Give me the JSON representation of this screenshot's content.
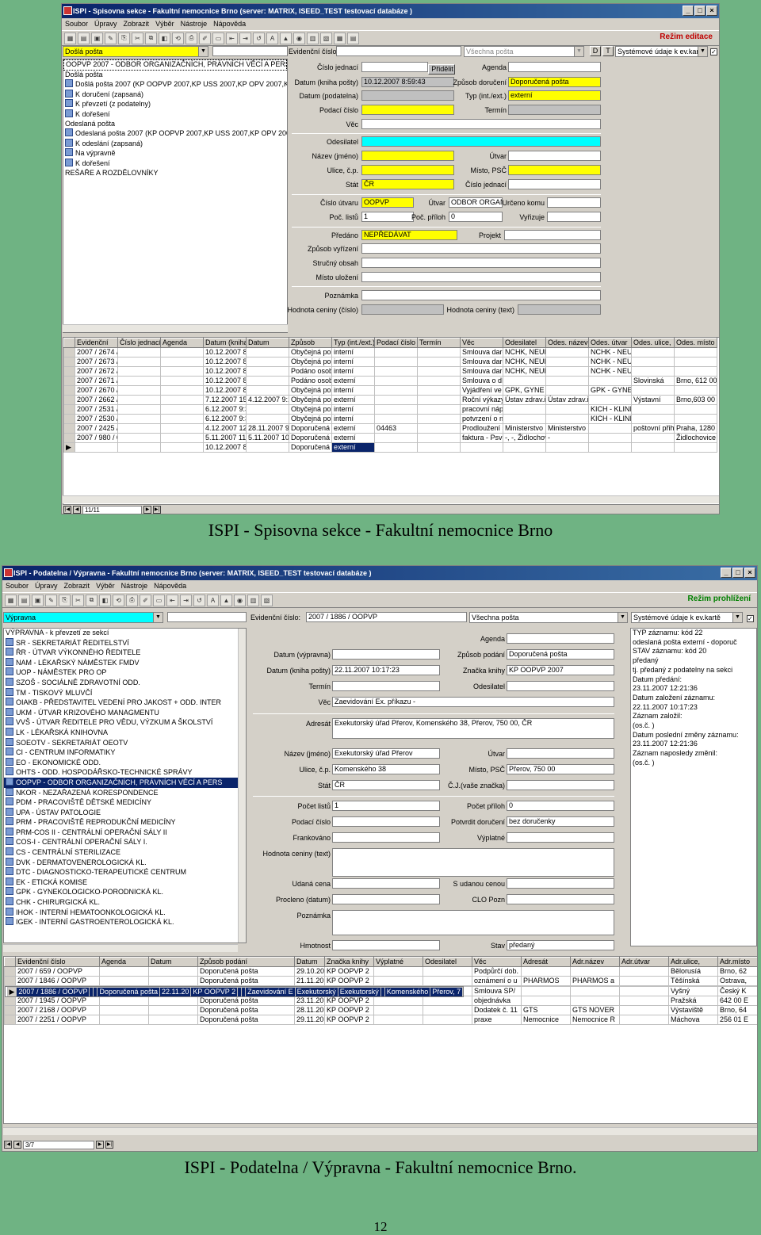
{
  "s1": {
    "title": "ISPI - Spisovna sekce - Fakultní nemocnice Brno (server: MATRIX, ISEED_TEST testovací databáze )",
    "menu": [
      "Soubor",
      "Úpravy",
      "Zobrazit",
      "Výběr",
      "Nástroje",
      "Nápověda"
    ],
    "mode": "Režim editace",
    "left_select": "Došlá pošta",
    "ev_label": "Evidenční číslo:",
    "posta_select": "Všechna pošta",
    "btn_d": "D",
    "btn_t": "T",
    "sys_select": "Systémové údaje k ev.kartě",
    "tree": [
      "OOPVP 2007 - ODBOR ORGANIZAČNÍCH, PRÁVNÍCH VĚCÍ A PERSONÁL",
      "Došlá pošta",
      "Došlá pošta 2007 (KP OOPVP 2007,KP USS 2007,KP OPV 2007,KP O",
      "K doručení (zapsaná)",
      "K převzetí (z podatelny)",
      "K dořešení",
      "Odeslaná pošta",
      "Odeslaná pošta 2007 (KP OOPVP 2007,KP USS 2007,KP OPV 2007,K",
      "K odeslání (zapsaná)",
      "Na výpravně",
      "K dořešení",
      "REŠAŘE A ROZDĚLOVNÍKY"
    ],
    "form": {
      "cislo_jednaci": "Číslo jednací",
      "pridelit": "Přidělit",
      "agenda": "Agenda",
      "datum_kniha": "Datum (kniha pošty)",
      "datum_kniha_v": "10.12.2007 8:59:43",
      "zpusob_doruceni": "Způsob doručení",
      "zpusob_doruceni_v": "Doporučená pošta",
      "datum_podatelna": "Datum (podatelna)",
      "typ": "Typ (int./ext.)",
      "typ_v": "externí",
      "podaci_cislo": "Podací číslo",
      "termin": "Termín",
      "vec": "Věc",
      "odesilatel": "Odesilatel",
      "nazev": "Název (jméno)",
      "utvar": "Útvar",
      "ulice": "Ulice, č.p.",
      "misto": "Místo, PSČ",
      "stat": "Stát",
      "stat_v": "ČR",
      "cislo_jednaci2": "Číslo jednací",
      "cislo_utvaru": "Číslo útvaru",
      "cislo_utvaru_v": "OOPVP",
      "utvar2": "Útvar",
      "utvar2_v": "ODBOR ORGAN",
      "urceno": "Určeno komu",
      "poc_listu": "Poč. listů",
      "poc_listu_v": "1",
      "poc_priloh": "Poč. příloh",
      "poc_priloh_v": "0",
      "vyrizuje": "Vyřizuje",
      "predano": "Předáno",
      "predano_v": "NEPŘEDÁVAT",
      "projekt": "Projekt",
      "zpusob_vyrizeni": "Způsob vyřízení",
      "strucny_obsah": "Stručný obsah",
      "misto_ulozeni": "Místo uložení",
      "poznamka": "Poznámka",
      "hodnota_cislo": "Hodnota ceniny (číslo)",
      "hodnota_text": "Hodnota ceniny (text)"
    },
    "cols": [
      "Evidenční",
      "Číslo jednací",
      "Agenda",
      "Datum (kniha",
      "Datum",
      "Způsob",
      "Typ (int./ext.)",
      "Podací číslo",
      "Termín",
      "Věc",
      "Odesilatel",
      "Odes. název",
      "Odes. útvar",
      "Odes. ulice,",
      "Odes. místo"
    ],
    "rows": [
      [
        "2007 / 2674 /",
        "",
        "",
        "10.12.2007 8:",
        "",
        "Obyčejná poš",
        "interní",
        "",
        "",
        "Smlouva daro",
        "NCHK, NEUR",
        "",
        "NCHK - NEUR",
        "",
        ""
      ],
      [
        "2007 / 2673 /",
        "",
        "",
        "10.12.2007 8:",
        "",
        "Obyčejná poš",
        "interní",
        "",
        "",
        "Smlouva daro",
        "NCHK, NEUR",
        "",
        "NCHK - NEUR",
        "",
        ""
      ],
      [
        "2007 / 2672 /",
        "",
        "",
        "10.12.2007 8:",
        "",
        "Podáno osob",
        "interní",
        "",
        "",
        "Smlouva daro",
        "NCHK, NEUR",
        "",
        "NCHK - NEUR",
        "",
        ""
      ],
      [
        "2007 / 2671 /",
        "",
        "",
        "10.12.2007 8:",
        "",
        "Podáno osob",
        "externí",
        "",
        "",
        "Smlouva o dí",
        "",
        "",
        "",
        "Slovinská",
        "Brno, 612 00"
      ],
      [
        "2007 / 2670 /",
        "",
        "",
        "10.12.2007 8:",
        "",
        "Obyčejná poš",
        "interní",
        "",
        "",
        "Vyjádření ve",
        "GPK, GYNE",
        "",
        "GPK - GYNE",
        "",
        ""
      ],
      [
        "2007 / 2662 /",
        "",
        "",
        "7.12.2007 15:",
        "4.12.2007 9:1",
        "Obyčejná poš",
        "externí",
        "",
        "",
        "Roční výkazy",
        "Ústav zdrav.in",
        "Ústav zdrav.ir",
        "",
        "Výstavní",
        "Brno,603 00"
      ],
      [
        "2007 / 2531 /",
        "",
        "",
        "6.12.2007 9:3",
        "",
        "Obyčejná poš",
        "interní",
        "",
        "",
        "pracovní náplň",
        "",
        "",
        "KICH - KLINI",
        "",
        ""
      ],
      [
        "2007 / 2530 /",
        "",
        "",
        "6.12.2007 9:3",
        "",
        "Obyčejná poš",
        "interní",
        "",
        "",
        "potvrzení o ná",
        "",
        "",
        "KICH - KLINI",
        "",
        ""
      ],
      [
        "2007 / 2425 /",
        "",
        "",
        "4.12.2007 12:",
        "28.11.2007 9:",
        "Doporučená p",
        "externí",
        "04463",
        "",
        "Prodloužení s",
        "Ministerstvo z",
        "Ministerstvo z",
        "",
        "poštovní přihr.",
        "Praha, 1280"
      ],
      [
        "2007 / 980 / 0",
        "",
        "",
        "5.11.2007 11:",
        "5.11.2007 10:",
        "Doporučená p",
        "externí",
        "",
        "",
        "faktura - Psve",
        "-, -, Židlochov",
        "-",
        "",
        "",
        "Židlochovice"
      ],
      [
        "",
        "",
        "",
        "10.12.2007 8:",
        "",
        "Doporučená p",
        "externí",
        "",
        "",
        "",
        "",
        "",
        "",
        "",
        ""
      ]
    ],
    "nav": "11/11"
  },
  "caption1": "ISPI - Spisovna sekce - Fakultní nemocnice Brno",
  "s2": {
    "title": "ISPI - Podatelna / Výpravna - Fakultní nemocnice Brno (server: MATRIX, ISEED_TEST testovací databáze )",
    "menu": [
      "Soubor",
      "Úpravy",
      "Zobrazit",
      "Výběr",
      "Nástroje",
      "Nápověda"
    ],
    "mode": "Režim prohlížení",
    "left_select": "Výpravna",
    "ev_label": "Evidenční číslo:",
    "ev_value": "2007 / 1886 / OOPVP",
    "posta_select": "Všechna pošta",
    "sys_select": "Systémové údaje k ev.kartě",
    "tree": [
      "VÝPRAVNA - k převzetí ze sekcí",
      "SR - SEKRETARIÁT ŘEDITELSTVÍ",
      "ŘR - ÚTVAR VÝKONNÉHO ŘEDITELE",
      "NAM - LÉKAŘSKÝ NÁMĚSTEK FMDV",
      "UOP - NÁMĚSTEK PRO OP",
      "SZOŠ - SOCIÁLNĚ ZDRAVOTNÍ ODD.",
      "TM - TISKOVÝ MLUVČÍ",
      "OIAKB - PŘEDSTAVITEL VEDENÍ PRO JAKOST + ODD. INTER",
      "UKM - ÚTVAR KRIZOVÉHO MANAGMENTU",
      "VVŠ - ÚTVAR ŘEDITELE PRO VĚDU, VÝZKUM A ŠKOLSTVÍ",
      "LK - LÉKAŘSKÁ KNIHOVNA",
      "SOEOTV - SEKRETARIÁT OEOTV",
      "CI - CENTRUM INFORMATIKY",
      "EO - EKONOMICKÉ ODD.",
      "OHTS - ODD. HOSPODÁŘSKO-TECHNICKÉ SPRÁVY",
      "OOPVP - ODBOR ORGANIZAČNÍCH, PRÁVNÍCH VĚCÍ A PERS",
      "NKOR - NEZAŘAZENÁ KORESPONDENCE",
      "PDM - PRACOVIŠTĚ DĚTSKÉ MEDICÍNY",
      "UPA - ÚSTAV PATOLOGIE",
      "PRM - PRACOVIŠTĚ REPRODUKČNÍ MEDICÍNY",
      "PRM-COS II - CENTRÁLNÍ OPERAČNÍ SÁLY II",
      "COS-I - CENTRÁLNÍ OPERAČNÍ SÁLY I.",
      "CS - CENTRÁLNÍ STERILIZACE",
      "DVK - DERMATOVENEROLOGICKÁ KL.",
      "DTC - DIAGNOSTICKO-TERAPEUTICKÉ CENTRUM",
      "EK - ETICKÁ KOMISE",
      "GPK - GYNEKOLOGICKO-PORODNICKÁ KL.",
      "CHK - CHIRURGICKÁ KL.",
      "IHOK - INTERNÍ HEMATOONKOLOGICKÁ KL.",
      "IGEK - INTERNÍ GASTROENTEROLOGICKÁ KL."
    ],
    "tree_selected": 15,
    "form": {
      "agenda": "Agenda",
      "datum_vyprava": "Datum (výpravna)",
      "zpusob_podani": "Způsob podání",
      "zpusob_podani_v": "Doporučená pošta",
      "datum_kniha": "Datum (kniha pošty)",
      "datum_kniha_v": "22.11.2007 10:17:23",
      "znacka": "Značka knihy",
      "znacka_v": "KP OOPVP 2007",
      "termin": "Termín",
      "odesilatel": "Odesilatel",
      "vec": "Věc",
      "vec_v": "Zaevidování Ex. příkazu -",
      "adresat": "Adresát",
      "adresat_v": "Exekutorský úřad Přerov, Komenského 38, Přerov, 750 00, ČR",
      "nazev": "Název (jméno)",
      "nazev_v": "Exekutorský úřad Přerov",
      "utvar": "Útvar",
      "ulice": "Ulice, č.p.",
      "ulice_v": "Komenského 38",
      "misto": "Místo, PSČ",
      "misto_v": "Přerov, 750 00",
      "stat": "Stát",
      "stat_v": "ČR",
      "cj": "Č.J.(vaše značka)",
      "pocet_listu": "Počet listů",
      "pocet_listu_v": "1",
      "pocet_priloh": "Počet příloh",
      "pocet_priloh_v": "0",
      "podaci_cislo": "Podací číslo",
      "potvrdit": "Potvrdit doručení",
      "potvrdit_v": "bez doručenky",
      "frankovano": "Frankováno",
      "vyplatne": "Výplatné",
      "hodnota_text": "Hodnota ceniny (text)",
      "udana_cena": "Udaná cena",
      "s_udanou": "S udanou cenou",
      "procleno": "Procleno (datum)",
      "clo": "CLO Pozn",
      "poznamka": "Poznámka",
      "hmotnost": "Hmotnost",
      "stav": "Stav",
      "stav_v": "předaný"
    },
    "info": [
      "TYP záznamu:  kód  22",
      "   odeslaná pošta externí - doporuč",
      "STAV záznamu:  kód  20",
      "   předaný",
      "   tj. předaný z podatelny na sekci",
      "Datum předání:",
      "   23.11.2007 12:21:36",
      "Datum založení záznamu:",
      "   22.11.2007 10:17:23",
      "Záznam založil:",
      "                          (os.č.     )",
      "Datum poslední změny záznamu:",
      "   23.11.2007 12:21:36",
      "Záznam naposledy změnil:",
      "                          (os.č.      )"
    ],
    "cols": [
      "Evidenční číslo",
      "Agenda",
      "Datum",
      "Způsob podání",
      "Datum",
      "Značka knihy",
      "Výplatné",
      "Odesilatel",
      "Věc",
      "Adresát",
      "Adr.název",
      "Adr.útvar",
      "Adr.ulice,",
      "Adr.místo"
    ],
    "rows": [
      [
        "2007 / 659 / OOPVP",
        "",
        "",
        "Doporučená pošta",
        "29.10.20",
        "KP OOPVP 2",
        "",
        "",
        "Podpůrčí dob.",
        "",
        "",
        "",
        "Bělorusíá",
        "Brno, 62"
      ],
      [
        "2007 / 1846 / OOPVP",
        "",
        "",
        "Doporučená pošta",
        "21.11.20",
        "KP OOPVP 2",
        "",
        "",
        "oznámení o u",
        "PHARMOS",
        "PHARMOS a",
        "",
        "Těšínská",
        "Ostrava,"
      ],
      [
        "2007 / 1886 / OOPVP",
        "",
        "",
        "Doporučená pošta",
        "22.11.20",
        "KP OOPVP 2",
        "",
        "",
        "Zaevidování E",
        "Exekutorský",
        "Exekutorský",
        "",
        "Komenského",
        "Přerov, 7"
      ],
      [
        "2007 / 1905 / OOPVP",
        "",
        "",
        "Doporučená pošta",
        "22.11.20",
        "KP OOPVP 2",
        "",
        "",
        "Smlouva SP/",
        "",
        "",
        "",
        "Vyšný",
        "Český K"
      ],
      [
        "2007 / 1945 / OOPVP",
        "",
        "",
        "Doporučená pošta",
        "23.11.20",
        "KP OOPVP 2",
        "",
        "",
        "objednávka",
        "",
        "",
        "",
        "Pražská",
        "642 00 E"
      ],
      [
        "2007 / 2168 / OOPVP",
        "",
        "",
        "Doporučená pošta",
        "28.11.20",
        "KP OOPVP 2",
        "",
        "",
        "Dodatek č. 11",
        "GTS",
        "GTS NOVER",
        "",
        "Výstaviště",
        "Brno, 64"
      ],
      [
        "2007 / 2251 / OOPVP",
        "",
        "",
        "Doporučená pošta",
        "29.11.20",
        "KP OOPVP 2",
        "",
        "",
        "praxe",
        "Nemocnice",
        "Nemocnice R",
        "",
        "Máchova",
        "256 01 E"
      ]
    ],
    "selected_row": 2,
    "nav": "3/7"
  },
  "caption2": "ISPI - Podatelna / Výpravna - Fakultní nemocnice Brno.",
  "page_number": "12"
}
